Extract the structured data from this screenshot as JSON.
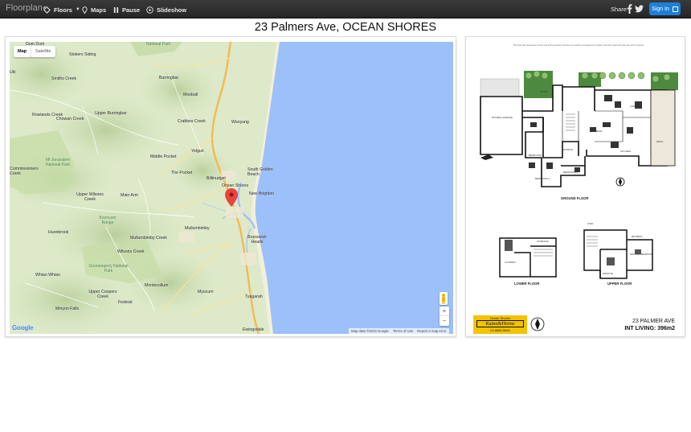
{
  "app": {
    "brand": "Floorplan"
  },
  "nav": {
    "floors": "Floors",
    "maps": "Maps",
    "pause": "Pause",
    "slideshow": "Slideshow",
    "share": "Share",
    "sign_in": "Sign In"
  },
  "page": {
    "title": "23 Palmers Ave, OCEAN SHORES"
  },
  "map": {
    "type_map": "Map",
    "type_satellite": "Satellite",
    "zoom_in": "+",
    "zoom_out": "−",
    "logo": "Google",
    "footer": {
      "data": "Map data ©2016 Google",
      "terms": "Terms of Use",
      "report": "Report a map error"
    },
    "places": {
      "dum_dum": "Dum Dum",
      "stokers_siding": "Stokers Siding",
      "national_park": "National Park",
      "uki": "Uki",
      "smiths_creek": "Smiths Creek",
      "burringbar": "Burringbar",
      "rowlands_creek": "Rowlands Creek",
      "upper_burringbar": "Upper Burringbar",
      "chowan_creek": "Chowan Creek",
      "mooball": "Mooball",
      "crabbes_creek": "Crabbes Creek",
      "wooyung": "Wooyung",
      "yelgun": "Yelgun",
      "middle_pocket": "Middle Pocket",
      "commissioners_creek": "Commissioners Creek",
      "mt_jerusalem": "Mt Jerusalem National Park",
      "the_pocket": "The Pocket",
      "billinudgel": "Billinudgel",
      "south_golden_beach": "South Golden Beach",
      "ocean_shores": "Ocean Shores",
      "new_brighton": "New Brighton",
      "upper_wilsons_creek": "Upper Wilsons Creek",
      "main_arm": "Main Arm",
      "koonyum_range": "Koonyum Range",
      "huonbrook": "Huonbrook",
      "mullumbimby": "Mullumbimby",
      "mullumbimby_creek": "Mullumbimby Creek",
      "brunswick_heads": "Brunswick Heads",
      "wilsons_creek": "Wilsons Creek",
      "goonengerry": "Goonengerry National Park",
      "whian_whian": "Whian Whian",
      "montecollum": "Montecollum",
      "upper_coopers_creek": "Upper Coopers Creek",
      "myocum": "Myocum",
      "tyagarah": "Tyagarah",
      "federal": "Federal",
      "minyon_falls": "Minyon Falls",
      "ewingsdale": "Ewingsdale"
    }
  },
  "floorplan": {
    "disclaimer": "This floor plan represents current use of the property and does not need to correspond or conform Council's approved plan use of the property.",
    "ground_floor": "GROUND FLOOR",
    "lower_floor": "LOWER FLOOR",
    "upper_floor": "UPPER FLOOR",
    "rooms": {
      "double_garage": "DOUBLE GARAGE",
      "study": "STUDY",
      "living": "LIVING",
      "media": "MEDIA",
      "kitchen": "KITCHEN",
      "deck": "DECK",
      "rumpus": "RUMPUS",
      "bedroom2": "BEDROOM 2",
      "bedroom3": "BEDROOM 3",
      "bedroom4": "BEDROOM 4",
      "laundry": "LAUNDRY",
      "storage": "STORAGE",
      "void": "VOID",
      "retreat": "RETREAT",
      "master_bedroom": "MASTER BEDROOM",
      "ensuite": "ENSUITE"
    },
    "agency_top": "Ocean Shores",
    "agency_name": "Raine&Horne",
    "agency_phone": "02 6680 5000",
    "address": "23 PALMER AVE",
    "living_area": "INT LIVING: 396m2"
  },
  "colors": {
    "accent": "#1e7fd9",
    "navbar": "#2c2c2c",
    "ocean": "#9cc0f9",
    "land": "#d9e6c2",
    "agency": "#f3c300"
  }
}
